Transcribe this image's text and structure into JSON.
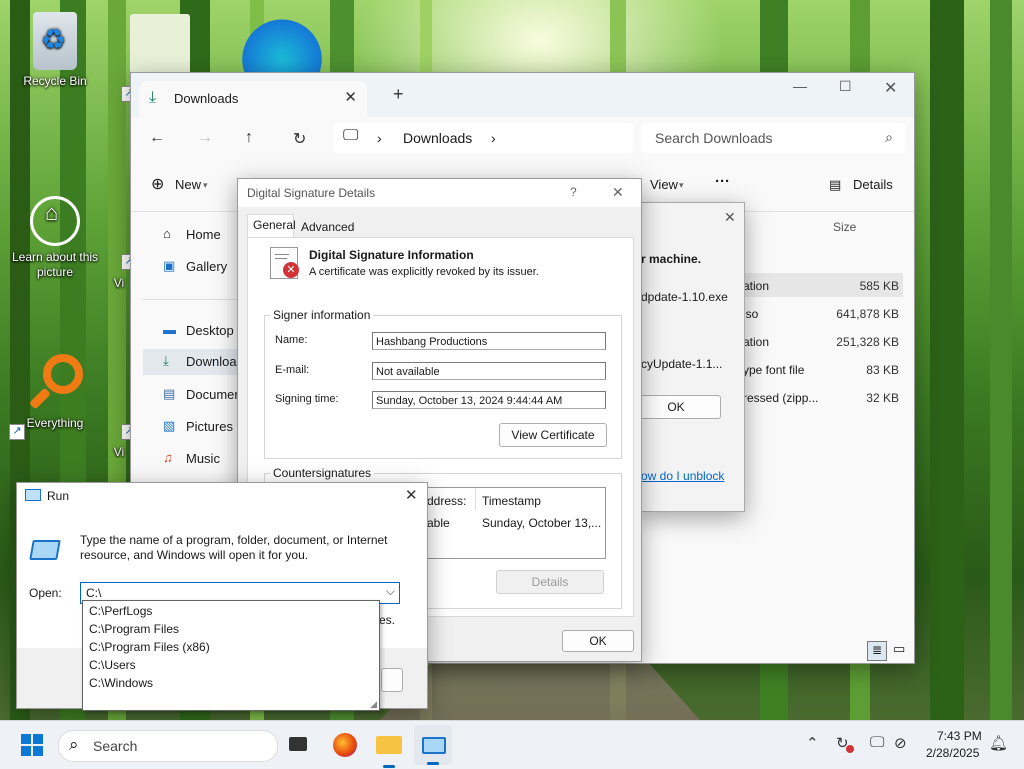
{
  "desktop": {
    "icons": [
      {
        "label": "Recycle Bin"
      },
      {
        "label": "Learn about this picture"
      },
      {
        "label": "Everything"
      }
    ],
    "partial_labels": [
      "Vi",
      "Vi"
    ]
  },
  "explorer": {
    "tab_title": "Downloads",
    "address": [
      "Downloads"
    ],
    "search_placeholder": "Search Downloads",
    "commands": {
      "new": "New",
      "view": "View",
      "details": "Details"
    },
    "sidebar": [
      {
        "label": "Home"
      },
      {
        "label": "Gallery"
      },
      {
        "label": "Desktop"
      },
      {
        "label": "Downloads"
      },
      {
        "label": "Documents"
      },
      {
        "label": "Pictures"
      },
      {
        "label": "Music"
      }
    ],
    "size_header": "Size",
    "rows": [
      {
        "type": "ation",
        "size": "585 KB"
      },
      {
        "type": "iso",
        "size": "641,878 KB"
      },
      {
        "type": "ation",
        "size": "251,328 KB"
      },
      {
        "type": "ype font file",
        "size": "83 KB"
      },
      {
        "type": "ressed (zipp...",
        "size": "32 KB"
      }
    ]
  },
  "security_warning": {
    "heading": "r machine.",
    "file1": "dpdate-1.10.exe",
    "file2": "cyUpdate-1.1...",
    "ok": "OK",
    "link": "ow do I unblock"
  },
  "signature_dialog": {
    "title": "Digital Signature Details",
    "help": "?",
    "tabs": [
      "General",
      "Advanced"
    ],
    "info_heading": "Digital Signature Information",
    "info_text": "A certificate was explicitly revoked by its issuer.",
    "signer_group": "Signer information",
    "name_label": "Name:",
    "name_value": "Hashbang Productions",
    "email_label": "E-mail:",
    "email_value": "Not available",
    "time_label": "Signing time:",
    "time_value": "Sunday, October 13, 2024 9:44:44 AM",
    "view_cert": "View Certificate",
    "counter_group": "Countersignatures",
    "counter_cols": [
      "ddress:",
      "Timestamp"
    ],
    "counter_row": [
      "able",
      "Sunday, October 13,..."
    ],
    "details": "Details",
    "ok": "OK"
  },
  "run_dialog": {
    "title": "Run",
    "description": "Type the name of a program, folder, document, or Internet resource, and Windows will open it for you.",
    "open_label": "Open:",
    "open_value": "C:\\",
    "hidden_fragment": "es.",
    "suggestions": [
      "C:\\PerfLogs",
      "C:\\Program Files",
      "C:\\Program Files (x86)",
      "C:\\Users",
      "C:\\Windows"
    ]
  },
  "taskbar": {
    "search_placeholder": "Search",
    "time": "7:43 PM",
    "date": "2/28/2025"
  },
  "colors": {
    "accent": "#0067c0",
    "revoked": "#d13438",
    "explorer_green": "#1a7f64"
  }
}
